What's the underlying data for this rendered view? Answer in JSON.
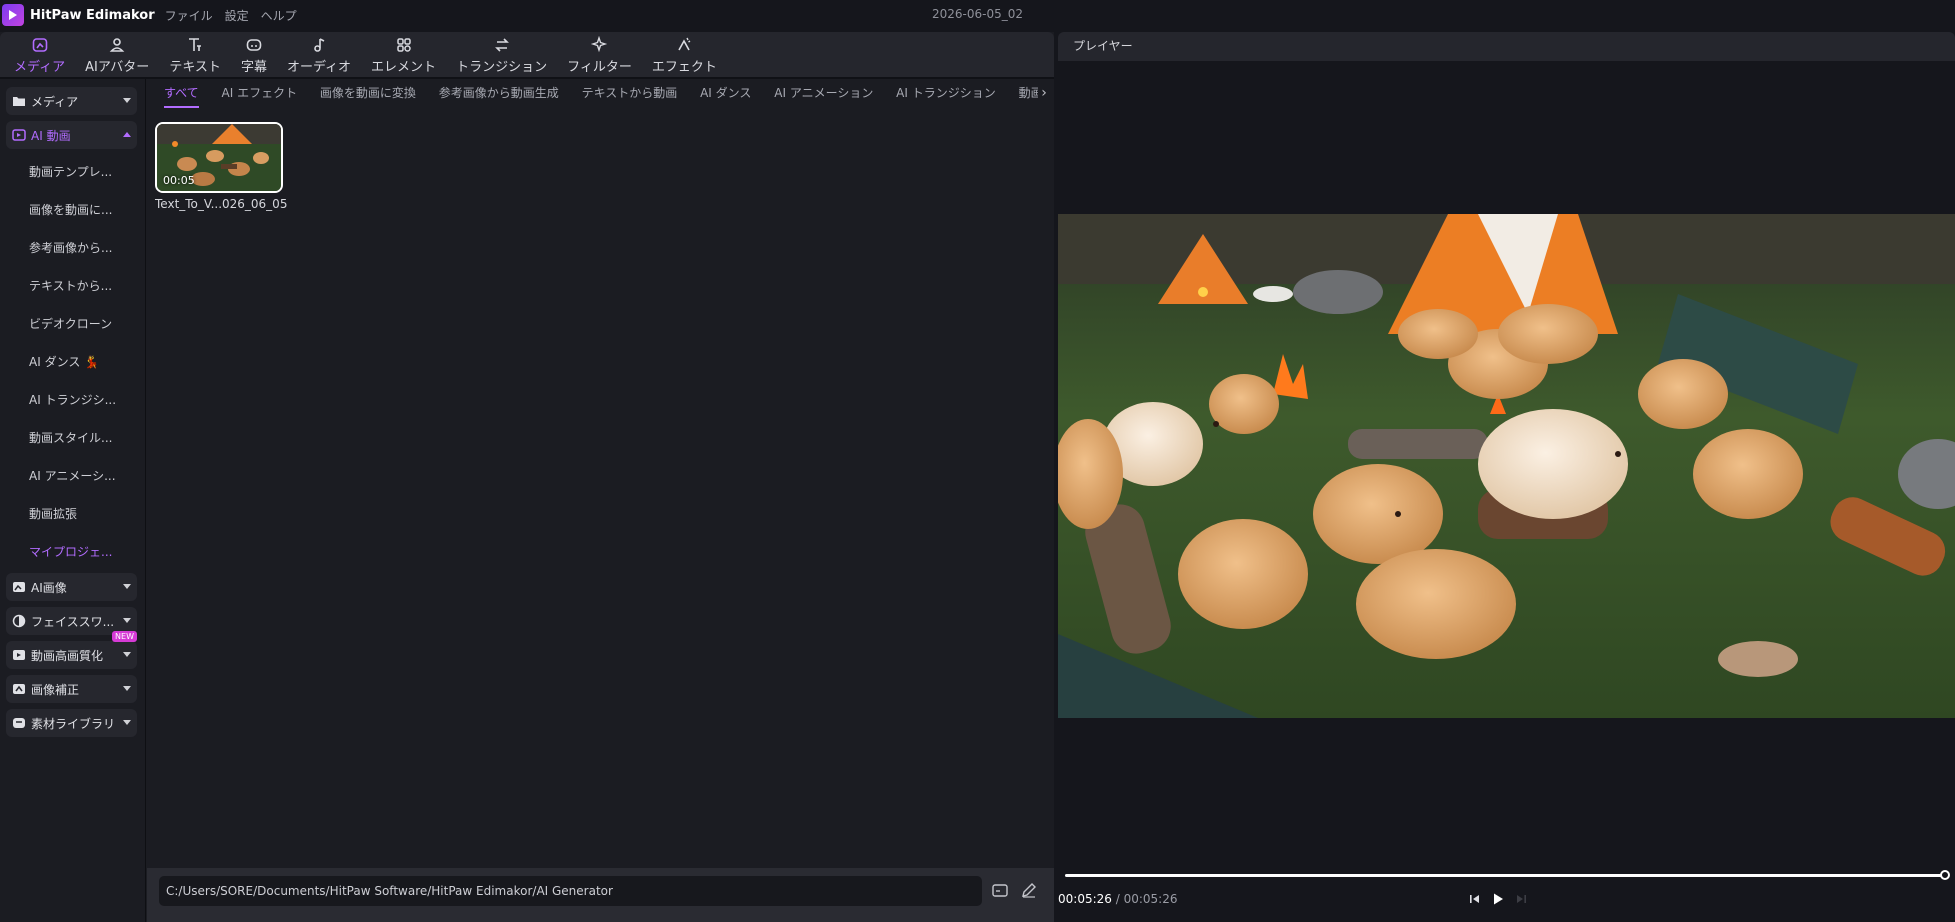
{
  "app": {
    "name": "HitPaw Edimakor",
    "menu": [
      "ファイル",
      "設定",
      "ヘルプ"
    ],
    "project_title": "2026-06-05_02"
  },
  "toolbar": [
    {
      "label": "メディア",
      "icon": "media-icon",
      "active": true
    },
    {
      "label": "AIアバター",
      "icon": "avatar-icon"
    },
    {
      "label": "テキスト",
      "icon": "text-icon"
    },
    {
      "label": "字幕",
      "icon": "subtitle-icon"
    },
    {
      "label": "オーディオ",
      "icon": "audio-icon"
    },
    {
      "label": "エレメント",
      "icon": "element-icon"
    },
    {
      "label": "トランジション",
      "icon": "transition-icon"
    },
    {
      "label": "フィルター",
      "icon": "filter-icon"
    },
    {
      "label": "エフェクト",
      "icon": "effect-icon"
    }
  ],
  "sidebar": {
    "groups": [
      {
        "label": "メディア",
        "icon": "folder-icon"
      },
      {
        "label": "AI 動画",
        "icon": "ai-video-icon",
        "active": true,
        "expanded": true
      }
    ],
    "ai_video_items": [
      "動画テンプレ...",
      "画像を動画に...",
      "参考画像から...",
      "テキストから...",
      "ビデオクローン",
      "AI ダンス 💃",
      "AI トランジシ...",
      "動画スタイル...",
      "AI アニメーシ...",
      "動画拡張",
      "マイプロジェ..."
    ],
    "lower_groups": [
      {
        "label": "AI画像",
        "icon": "ai-image-icon"
      },
      {
        "label": "フェイススワ...",
        "icon": "face-swap-icon"
      },
      {
        "label": "動画高画質化",
        "icon": "upscale-icon",
        "badge": "NEW"
      },
      {
        "label": "画像補正",
        "icon": "image-enhance-icon"
      },
      {
        "label": "素材ライブラリ",
        "icon": "library-icon"
      }
    ]
  },
  "tabs": [
    "すべて",
    "AI エフェクト",
    "画像を動画に変換",
    "参考画像から動画生成",
    "テキストから動画",
    "AI ダンス",
    "AI アニメーション",
    "AI トランジション",
    "動画ス"
  ],
  "media_items": [
    {
      "duration": "00:05",
      "name": "Text_To_V...026_06_05"
    }
  ],
  "path_bar": {
    "path": "C:/Users/SORE/Documents/HitPaw Software/HitPaw Edimakor/AI Generator"
  },
  "player": {
    "header": "プレイヤー",
    "current_time": "00:05:26",
    "separator": " / ",
    "total_time": "00:05:26",
    "progress": 1.0
  },
  "colors": {
    "accent": "#b26cff",
    "background": "#15161c",
    "panel": "#1b1c22"
  }
}
